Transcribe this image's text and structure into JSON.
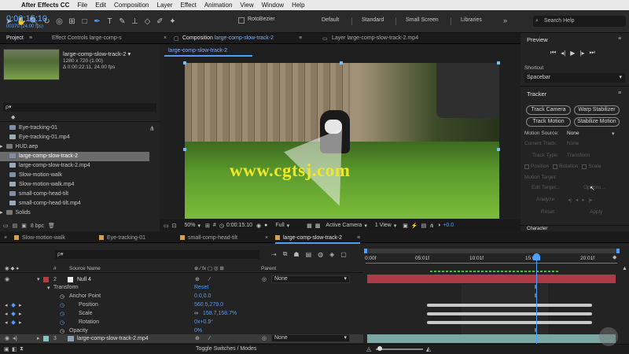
{
  "menubar": {
    "app_name": "After Effects CC",
    "items": [
      "File",
      "Edit",
      "Composition",
      "Layer",
      "Effect",
      "Animation",
      "View",
      "Window",
      "Help"
    ]
  },
  "toolbar": {
    "rotobezier_label": "RotoBezier",
    "workspaces": [
      "Default",
      "Standard",
      "Small Screen",
      "Libraries"
    ],
    "search_placeholder": "Search Help"
  },
  "project": {
    "tab_label": "Project",
    "effect_controls_tab": "Effect Controls large-comp-s",
    "selected_name": "large-comp-slow-track-2 ▾",
    "selected_size": "1280 x 720 (1.00)",
    "selected_duration": "Δ 0:00:22:11, 24.00 fps",
    "search_placeholder": "ρ▾",
    "items": [
      {
        "name": "Eye-tracking-01",
        "type": "comp",
        "selected": false
      },
      {
        "name": "Eye-tracking-01.mp4",
        "type": "footage",
        "selected": false
      },
      {
        "name": "HUD.aep",
        "type": "folder",
        "selected": false
      },
      {
        "name": "large-comp-slow-track-2",
        "type": "comp",
        "selected": true
      },
      {
        "name": "large-comp-slow-track-2.mp4",
        "type": "footage",
        "selected": false
      },
      {
        "name": "Slow-motion-walk",
        "type": "comp",
        "selected": false
      },
      {
        "name": "Slow-motion-walk.mp4",
        "type": "footage",
        "selected": false
      },
      {
        "name": "small-comp-head-tilt",
        "type": "comp",
        "selected": false
      },
      {
        "name": "small-comp-head-tilt.mp4",
        "type": "footage",
        "selected": false
      },
      {
        "name": "Solids",
        "type": "folder",
        "selected": false
      }
    ],
    "bpc": "8 bpc"
  },
  "composition": {
    "tab_prefix": "Composition",
    "tab_name": "large-comp-slow-track-2",
    "layer_tab": "Layer large-comp-slow-track-2.mp4",
    "sub_tab": "large-comp-slow-track-2",
    "watermark": "www.cgtsj.com",
    "zoom": "50%",
    "timecode": "0:00:15:10",
    "resolution": "Full",
    "camera": "Active Camera",
    "view": "1 View",
    "exposure": "+0.0"
  },
  "preview": {
    "title": "Preview",
    "shortcut_label": "Shortcut",
    "shortcut_value": "Spacebar"
  },
  "tracker": {
    "title": "Tracker",
    "buttons": [
      "Track Camera",
      "Warp Stabilizer",
      "Track Motion",
      "Stabilize Motion"
    ],
    "motion_source_label": "Motion Source:",
    "motion_source_value": "None",
    "current_track_label": "Current Track:",
    "current_track_value": "None",
    "track_type_label": "Track Type:",
    "track_type_value": "Transform",
    "position_label": "Position",
    "rotation_label": "Rotation",
    "scale_label": "Scale",
    "motion_target_label": "Motion Target:",
    "edit_target": "Edit Target...",
    "options": "Options...",
    "analyze_label": "Analyze:",
    "reset": "Reset",
    "apply": "Apply",
    "next_panel": "Character"
  },
  "timeline": {
    "tabs": [
      {
        "label": "Slow-motion-walk",
        "color": "#d6a14a"
      },
      {
        "label": "Eye-tracking-01",
        "color": "#d6a14a"
      },
      {
        "label": "small-comp-head-tilt",
        "color": "#d6a14a"
      },
      {
        "label": "large-comp-slow-track-2",
        "color": "#d6a14a"
      }
    ],
    "timecode": "0:00:15:10",
    "frame_info": "00370 (24.00 fps)",
    "search_placeholder": "ρ▾",
    "col_source": "Source Name",
    "col_parent": "Parent",
    "ruler": [
      "0:00f",
      "05:01f",
      "10:01f",
      "15:0",
      "20:01f"
    ],
    "layer1": {
      "index": "2",
      "name": "Null 4",
      "parent": "None"
    },
    "transform_label": "Transform",
    "transform_reset": "Reset",
    "props": [
      {
        "name": "Anchor Point",
        "value": "0.0,0.0"
      },
      {
        "name": "Position",
        "value": "560.5,279.0"
      },
      {
        "name": "Scale",
        "value": "158.7,158.7%"
      },
      {
        "name": "Rotation",
        "value": "0x+0.9°"
      },
      {
        "name": "Opacity",
        "value": "0%"
      }
    ],
    "layer2": {
      "index": "3",
      "name": "large-comp-slow-track-2.mp4",
      "parent": "None"
    },
    "toggle_label": "Toggle Switches / Modes"
  }
}
